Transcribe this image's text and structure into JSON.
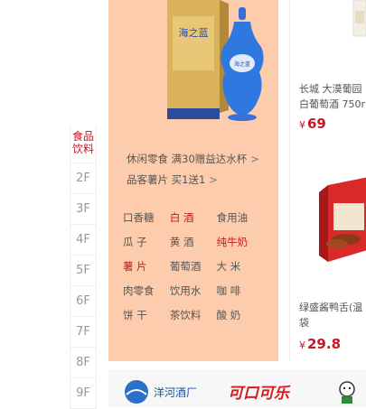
{
  "floor_nav": {
    "active_line1": "食品",
    "active_line2": "饮料",
    "floors": [
      "2F",
      "3F",
      "4F",
      "5F",
      "6F",
      "7F",
      "8F",
      "9F"
    ]
  },
  "promos": [
    {
      "text": "休闲零食 满30赠益达水杯",
      "arrow": ">"
    },
    {
      "text": "品客薯片 买1送1",
      "arrow": ">"
    }
  ],
  "keywords": [
    [
      {
        "label": "口香糖",
        "hot": false
      },
      {
        "label": "白  酒",
        "hot": true
      },
      {
        "label": "食用油",
        "hot": false
      }
    ],
    [
      {
        "label": "瓜  子",
        "hot": false
      },
      {
        "label": "黄  酒",
        "hot": false
      },
      {
        "label": "纯牛奶",
        "hot": true
      }
    ],
    [
      {
        "label": "薯  片",
        "hot": true
      },
      {
        "label": "葡萄酒",
        "hot": false
      },
      {
        "label": "大  米",
        "hot": false
      }
    ],
    [
      {
        "label": "肉零食",
        "hot": false
      },
      {
        "label": "饮用水",
        "hot": false
      },
      {
        "label": "咖  啡",
        "hot": false
      }
    ],
    [
      {
        "label": "饼  干",
        "hot": false
      },
      {
        "label": "茶饮料",
        "hot": false
      },
      {
        "label": "酸  奶",
        "hot": false
      }
    ]
  ],
  "products": {
    "wine": {
      "name_line1": "长城 大漠葡园",
      "name_line2": "白葡萄酒 750r",
      "currency": "¥",
      "price": "69"
    },
    "duck": {
      "name_line1": "绿盛酱鸭舌(温",
      "name_line2": "袋",
      "currency": "¥",
      "price": "29.8"
    }
  },
  "brands": {
    "b1": "洋河酒厂",
    "b2": "可口可乐"
  },
  "featured": {
    "box_text": "海之蓝",
    "bottle_text": "海之蓝"
  }
}
